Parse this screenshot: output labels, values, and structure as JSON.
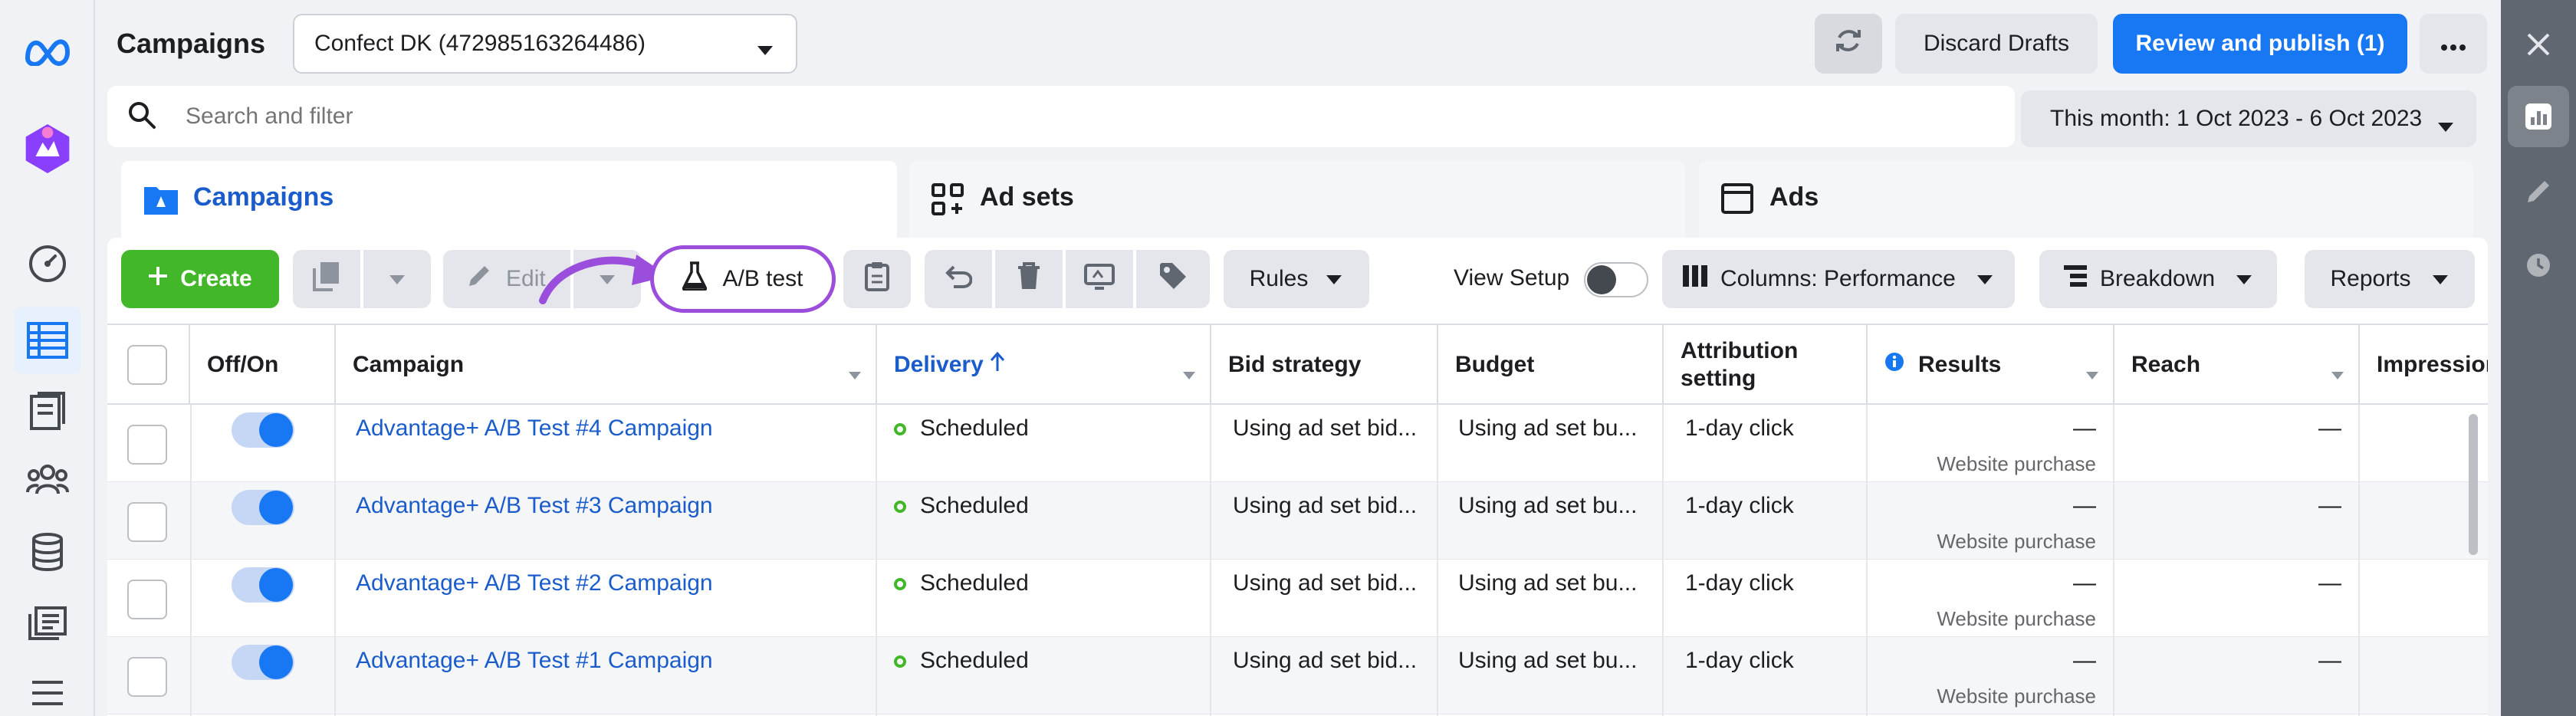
{
  "header": {
    "title": "Campaigns",
    "account_select": "Confect DK (472985163264486)",
    "discard_label": "Discard Drafts",
    "publish_label": "Review and publish (1)"
  },
  "search": {
    "placeholder": "Search and filter",
    "date_range": "This month: 1 Oct 2023 - 6 Oct 2023"
  },
  "tabs": [
    {
      "label": "Campaigns"
    },
    {
      "label": "Ad sets"
    },
    {
      "label": "Ads"
    }
  ],
  "toolbar": {
    "create_label": "Create",
    "edit_label": "Edit",
    "ab_test_label": "A/B test",
    "rules_label": "Rules",
    "view_setup_label": "View Setup",
    "columns_label": "Columns: Performance",
    "breakdown_label": "Breakdown",
    "reports_label": "Reports"
  },
  "table": {
    "headers": {
      "offon": "Off/On",
      "campaign": "Campaign",
      "delivery": "Delivery",
      "bid": "Bid strategy",
      "budget": "Budget",
      "attribution_1": "Attribution",
      "attribution_2": "setting",
      "results": "Results",
      "reach": "Reach",
      "impressions": "Impression"
    },
    "rows": [
      {
        "campaign": "Advantage+ A/B Test #4 Campaign",
        "delivery": "Scheduled",
        "bid": "Using ad set bid...",
        "budget": "Using ad set bu...",
        "attribution": "1-day click",
        "results": "—",
        "results_sub": "Website purchase",
        "reach": "—"
      },
      {
        "campaign": "Advantage+ A/B Test #3 Campaign",
        "delivery": "Scheduled",
        "bid": "Using ad set bid...",
        "budget": "Using ad set bu...",
        "attribution": "1-day click",
        "results": "—",
        "results_sub": "Website purchase",
        "reach": "—"
      },
      {
        "campaign": "Advantage+ A/B Test #2 Campaign",
        "delivery": "Scheduled",
        "bid": "Using ad set bid...",
        "budget": "Using ad set bu...",
        "attribution": "1-day click",
        "results": "—",
        "results_sub": "Website purchase",
        "reach": "—"
      },
      {
        "campaign": "Advantage+ A/B Test #1 Campaign",
        "delivery": "Scheduled",
        "bid": "Using ad set bid...",
        "budget": "Using ad set bu...",
        "attribution": "1-day click",
        "results": "—",
        "results_sub": "Website purchase",
        "reach": "—"
      }
    ]
  },
  "colors": {
    "primary_blue": "#1877f2",
    "link_blue": "#1a5ccc",
    "create_green": "#42b72a",
    "highlight_purple": "#9b4ddb",
    "sidebar_dark": "#606770"
  }
}
